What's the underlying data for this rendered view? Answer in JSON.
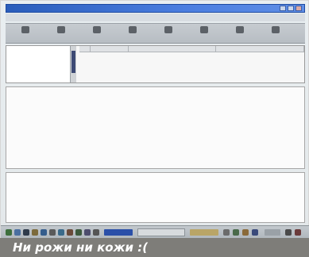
{
  "caption": "Ни рожи ни кожи :(",
  "window": {
    "title": "",
    "controls": [
      "minimize-icon",
      "maximize-icon",
      "close-icon"
    ]
  },
  "menu": [
    "",
    "",
    "",
    "",
    "",
    ""
  ],
  "toolbar": {
    "buttons": [
      {
        "label": "",
        "icon": "connect-icon"
      },
      {
        "label": "",
        "icon": "disconnect-icon"
      },
      {
        "label": "",
        "icon": "upload-icon"
      },
      {
        "label": "",
        "icon": "download-icon"
      },
      {
        "label": "",
        "icon": "delete-icon"
      },
      {
        "label": "",
        "icon": "properties-icon"
      },
      {
        "label": "",
        "icon": "search-icon"
      },
      {
        "label": "",
        "icon": "settings-icon"
      }
    ]
  },
  "tree": {
    "selected": "",
    "items": [
      "",
      "",
      "",
      ""
    ]
  },
  "list_columns": [
    "",
    "",
    "",
    ""
  ],
  "taskbar": {
    "tasks": [
      ""
    ]
  }
}
